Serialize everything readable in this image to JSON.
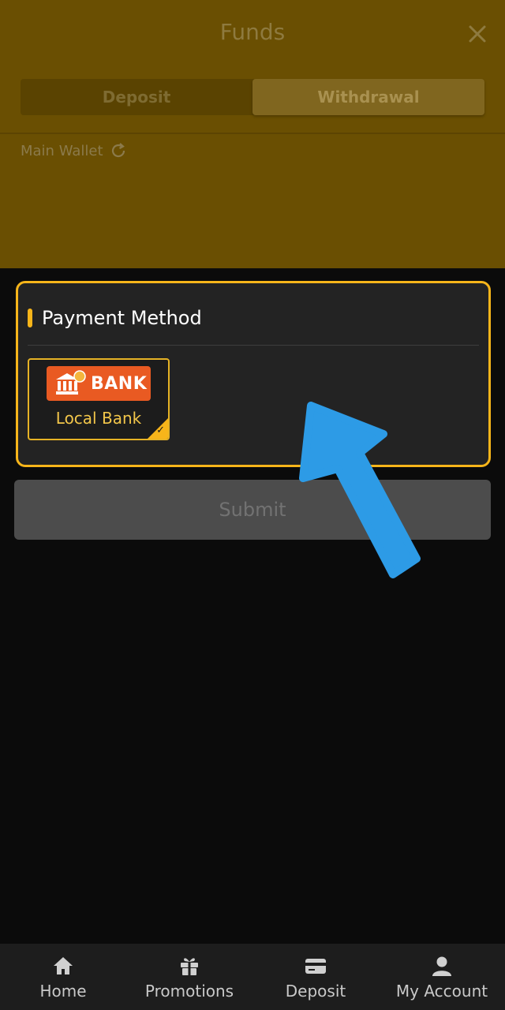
{
  "header": {
    "title": "Funds",
    "tabs": [
      {
        "label": "Deposit",
        "active": false
      },
      {
        "label": "Withdrawal",
        "active": true
      }
    ],
    "wallet_label": "Main Wallet"
  },
  "payment": {
    "heading": "Payment Method",
    "methods": [
      {
        "logo_text": "BANK",
        "label": "Local Bank",
        "selected": true
      }
    ]
  },
  "submit": {
    "label": "Submit"
  },
  "bottom_nav": [
    {
      "label": "Home",
      "icon": "home-icon"
    },
    {
      "label": "Promotions",
      "icon": "gift-icon"
    },
    {
      "label": "Deposit",
      "icon": "card-icon"
    },
    {
      "label": "My Account",
      "icon": "user-icon"
    }
  ],
  "colors": {
    "accent": "#f7b51a",
    "header_overlay": "#6a4f02",
    "bank_logo": "#e95a22",
    "arrow": "#2d9be6"
  }
}
